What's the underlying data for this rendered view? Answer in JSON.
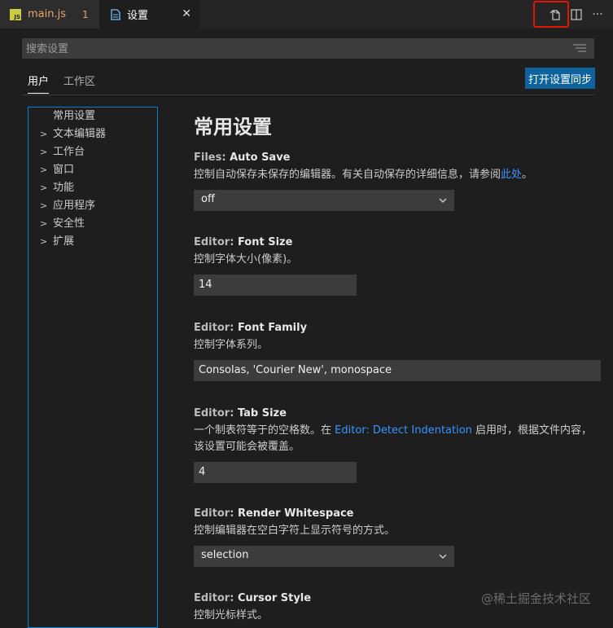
{
  "tabs": [
    {
      "label": "main.js",
      "badge": "1",
      "icon": "js-file-icon"
    },
    {
      "label": "设置",
      "icon": "settings-file-icon",
      "close": "✕"
    }
  ],
  "toolbar": {
    "open_json_icon": "open-settings-json-icon",
    "split_icon": "split-editor-icon",
    "more_label": "···"
  },
  "search": {
    "placeholder": "搜索设置"
  },
  "scope": {
    "user": "用户",
    "workspace": "工作区"
  },
  "sync_button": "打开设置同步",
  "toc": [
    {
      "label": "常用设置",
      "expandable": false
    },
    {
      "label": "文本编辑器",
      "expandable": true
    },
    {
      "label": "工作台",
      "expandable": true
    },
    {
      "label": "窗口",
      "expandable": true
    },
    {
      "label": "功能",
      "expandable": true
    },
    {
      "label": "应用程序",
      "expandable": true
    },
    {
      "label": "安全性",
      "expandable": true
    },
    {
      "label": "扩展",
      "expandable": true
    }
  ],
  "section_title": "常用设置",
  "settings": {
    "auto_save": {
      "category": "Files: ",
      "key": "Auto Save",
      "desc_before": "控制自动保存未保存的编辑器。有关自动保存的详细信息，请参阅",
      "desc_link": "此处",
      "desc_after": "。",
      "value": "off"
    },
    "font_size": {
      "category": "Editor: ",
      "key": "Font Size",
      "desc": "控制字体大小(像素)。",
      "value": "14"
    },
    "font_family": {
      "category": "Editor: ",
      "key": "Font Family",
      "desc": "控制字体系列。",
      "value": "Consolas, 'Courier New', monospace"
    },
    "tab_size": {
      "category": "Editor: ",
      "key": "Tab Size",
      "desc_before": "一个制表符等于的空格数。在 ",
      "desc_link": "Editor: Detect Indentation",
      "desc_after": " 启用时，根据文件内容，",
      "desc_line2": "该设置可能会被覆盖。",
      "value": "4"
    },
    "render_whitespace": {
      "category": "Editor: ",
      "key": "Render Whitespace",
      "desc": "控制编辑器在空白字符上显示符号的方式。",
      "value": "selection"
    },
    "cursor_style": {
      "category": "Editor: ",
      "key": "Cursor Style",
      "desc": "控制光标样式。"
    }
  },
  "watermark": "@稀土掘金技术社区",
  "colors": {
    "accent": "#0e639c",
    "link": "#3794ff",
    "highlight": "#e51400",
    "focus_border": "#007fd4"
  }
}
